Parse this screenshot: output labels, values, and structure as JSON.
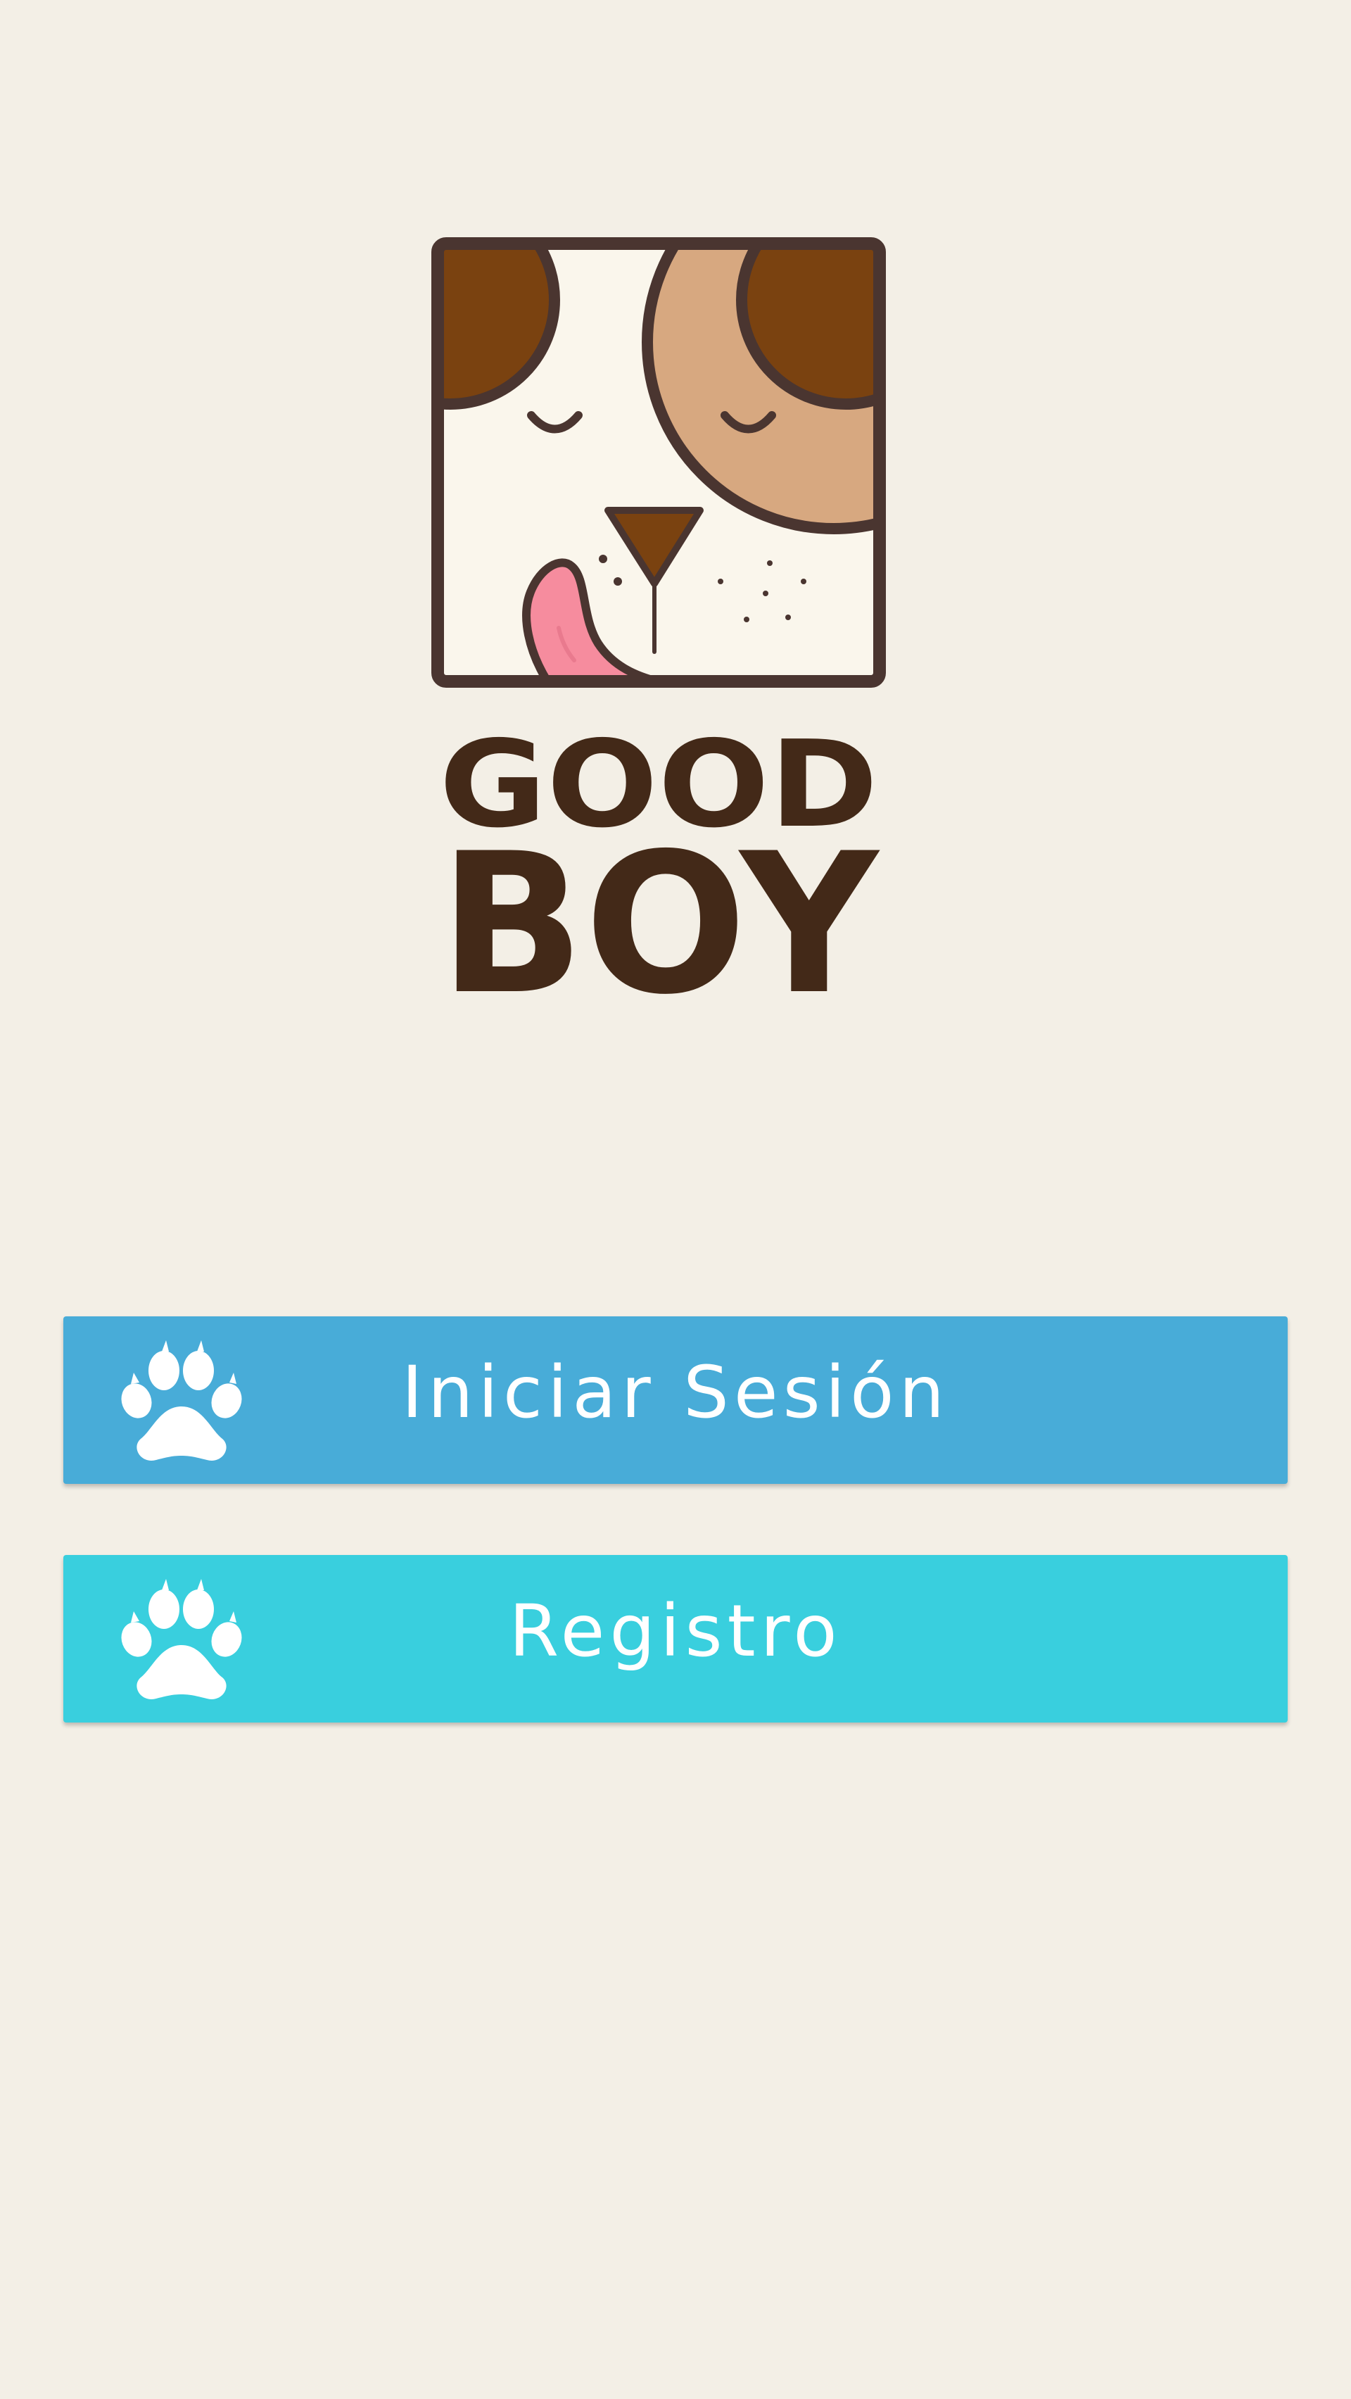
{
  "logo": {
    "word_top": "GOOD",
    "word_bottom": "BOY",
    "icon": "dog-face-icon"
  },
  "buttons": {
    "login": {
      "label": "Iniciar Sesión",
      "icon": "paw-icon",
      "color": "#48acd8"
    },
    "register": {
      "label": "Registro",
      "icon": "paw-icon",
      "color": "#39cfde"
    }
  },
  "colors": {
    "background": "#f3efe6",
    "logo_text": "#432918",
    "outline": "#4a3530"
  }
}
